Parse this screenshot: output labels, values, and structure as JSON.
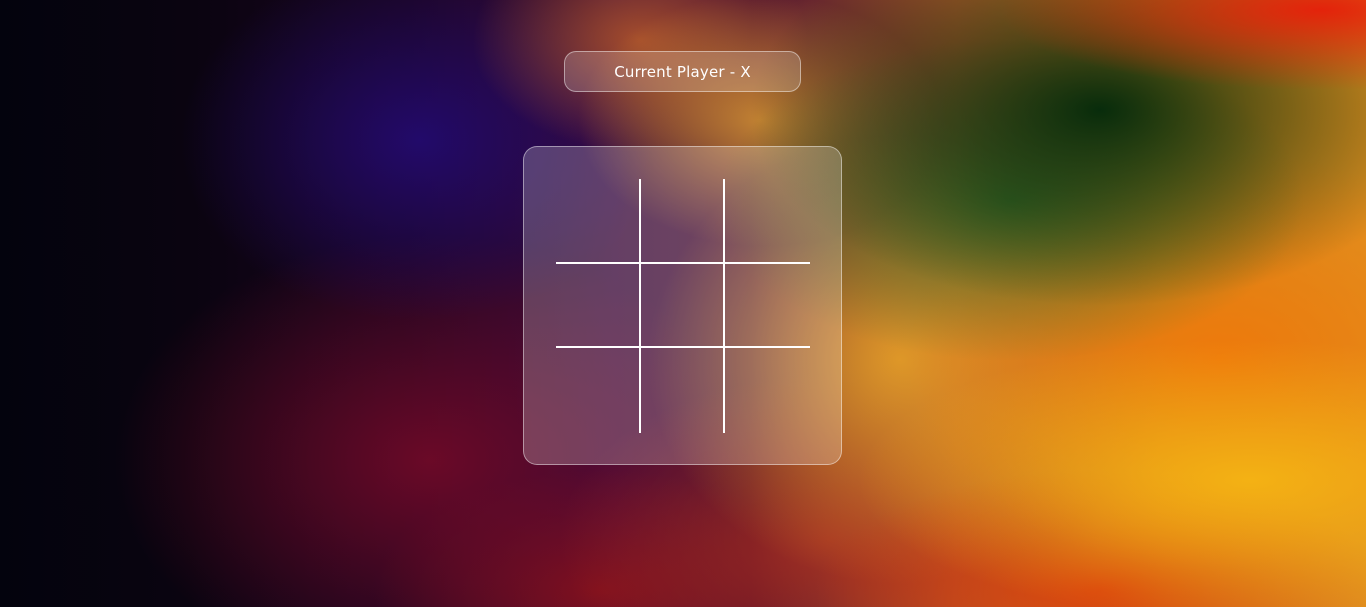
{
  "status": {
    "current_player_text": "Current Player - X"
  },
  "board": {
    "cells": [
      "",
      "",
      "",
      "",
      "",
      "",
      "",
      "",
      ""
    ]
  }
}
